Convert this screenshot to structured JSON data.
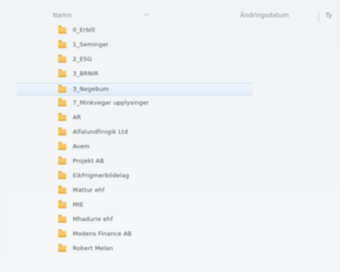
{
  "header": {
    "name_label": "Namn",
    "date_label": "Ändringsdatum",
    "type_label": "Ty"
  },
  "folders": [
    {
      "label": "0_Erbill"
    },
    {
      "label": "1_Seminger"
    },
    {
      "label": "2_ESG"
    },
    {
      "label": "3_BRNIR"
    },
    {
      "label": "3_Negebum"
    },
    {
      "label": "7_Minkvegar upplysinger"
    },
    {
      "label": "AR"
    },
    {
      "label": "Alfalundfinigik Ltd"
    },
    {
      "label": "Avem"
    },
    {
      "label": "Projekt AB"
    },
    {
      "label": "EikFrigmerbildelag"
    },
    {
      "label": "Mattur ehf"
    },
    {
      "label": "MIE"
    },
    {
      "label": "Mhadurie ehf"
    },
    {
      "label": "Modens Finance AB"
    },
    {
      "label": "Robert Melan"
    }
  ],
  "selected_index": 4
}
